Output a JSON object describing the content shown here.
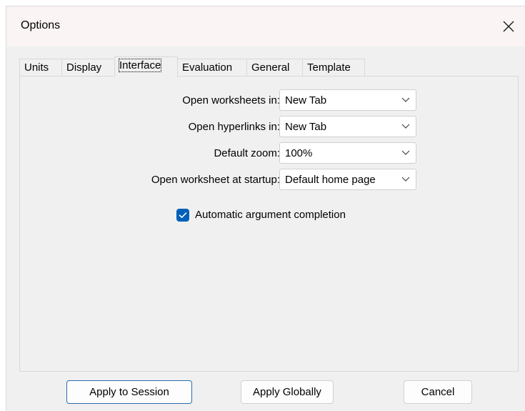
{
  "window": {
    "title": "Options"
  },
  "tabs": [
    {
      "label": "Units",
      "active": false
    },
    {
      "label": "Display",
      "active": false
    },
    {
      "label": "Interface",
      "active": true
    },
    {
      "label": "Evaluation",
      "active": false
    },
    {
      "label": "General",
      "active": false
    },
    {
      "label": "Template",
      "active": false
    }
  ],
  "fields": {
    "open_worksheets": {
      "label": "Open worksheets in:",
      "value": "New Tab"
    },
    "open_hyperlinks": {
      "label": "Open hyperlinks in:",
      "value": "New Tab"
    },
    "default_zoom": {
      "label": "Default zoom:",
      "value": "100%"
    },
    "open_at_startup": {
      "label": "Open worksheet at startup:",
      "value": "Default home page"
    }
  },
  "checkbox": {
    "label": "Automatic argument completion",
    "checked": true
  },
  "buttons": {
    "apply_session": "Apply to Session",
    "apply_globally": "Apply Globally",
    "cancel": "Cancel"
  },
  "colors": {
    "accent": "#005fb8",
    "dialog_bg": "#f0f0f0",
    "titlebar_bg": "#fbf4f4"
  },
  "icons": {
    "close": "close-icon",
    "dropdown": "chevron-down-icon",
    "check": "checkmark-icon"
  }
}
